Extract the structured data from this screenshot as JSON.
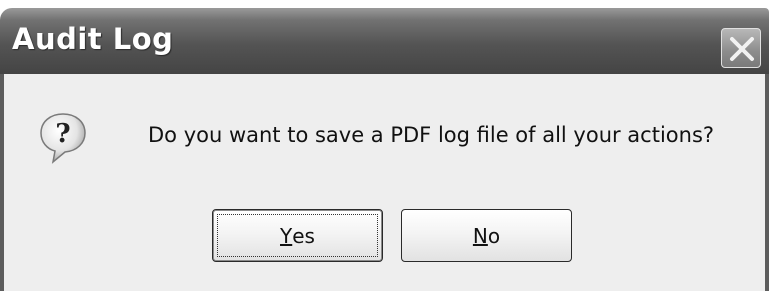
{
  "window": {
    "title": "Audit Log",
    "close_icon": "close-icon"
  },
  "dialog": {
    "icon": "question-icon",
    "message": "Do you want to save a PDF log file of all your actions?"
  },
  "buttons": {
    "yes": {
      "mnemonic": "Y",
      "rest": "es",
      "is_default": true
    },
    "no": {
      "mnemonic": "N",
      "rest": "o",
      "is_default": false
    }
  }
}
